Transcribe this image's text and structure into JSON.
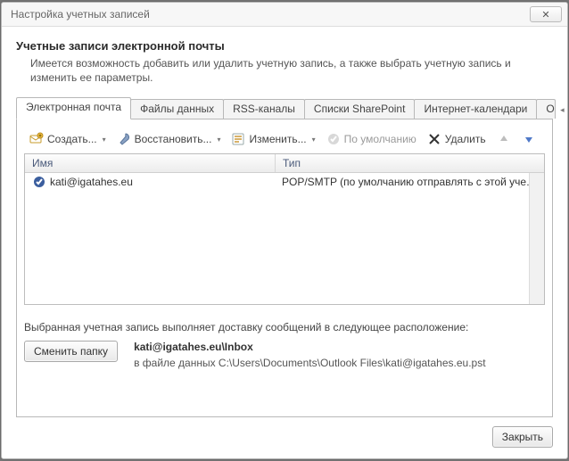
{
  "window_title": "Настройка учетных записей",
  "heading": "Учетные записи электронной почты",
  "subheading": "Имеется возможность добавить или удалить учетную запись, а также выбрать учетную запись и изменить ее параметры.",
  "tabs": [
    {
      "label": "Электронная почта",
      "active": true
    },
    {
      "label": "Файлы данных",
      "active": false
    },
    {
      "label": "RSS-каналы",
      "active": false
    },
    {
      "label": "Списки SharePoint",
      "active": false
    },
    {
      "label": "Интернет-календари",
      "active": false
    },
    {
      "label": "Опубликова",
      "active": false
    }
  ],
  "toolbar": {
    "create": "Создать...",
    "restore": "Восстановить...",
    "edit": "Изменить...",
    "default": "По умолчанию",
    "delete": "Удалить"
  },
  "columns": {
    "name": "Имя",
    "type": "Тип"
  },
  "rows": [
    {
      "name": "kati@igatahes.eu",
      "type": "POP/SMTP (по умолчанию отправлять с этой учет..."
    }
  ],
  "delivery_line": "Выбранная учетная запись выполняет доставку сообщений в следующее расположение:",
  "change_folder_btn": "Сменить папку",
  "delivery_path_strong": "kati@igatahes.eu\\Inbox",
  "delivery_path_sub": "в файле данных C:\\Users\\Documents\\Outlook Files\\kati@igatahes.eu.pst",
  "close_btn": "Закрыть"
}
